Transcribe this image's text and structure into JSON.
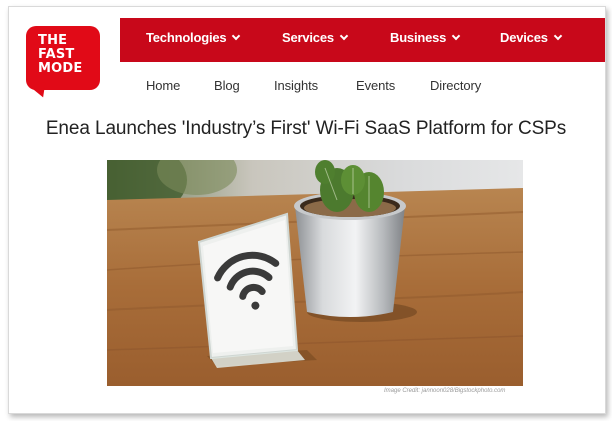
{
  "brand": {
    "logo_lines": [
      "THE",
      "FAST",
      "MODE"
    ],
    "accent": "#c8081a",
    "logo_color": "#e10a17"
  },
  "top_nav": {
    "items": [
      {
        "label": "Technologies",
        "icon": "chevron-down-icon"
      },
      {
        "label": "Services",
        "icon": "chevron-down-icon"
      },
      {
        "label": "Business",
        "icon": "chevron-down-icon"
      },
      {
        "label": "Devices",
        "icon": "chevron-down-icon"
      }
    ]
  },
  "sub_nav": {
    "items": [
      "Home",
      "Blog",
      "Insights",
      "Events",
      "Directory"
    ]
  },
  "article": {
    "headline": "Enea Launches 'Industry’s First' Wi-Fi SaaS Platform for CSPs",
    "image_credit": "Image Credit: jannoon028/Bigstockphoto.com"
  }
}
